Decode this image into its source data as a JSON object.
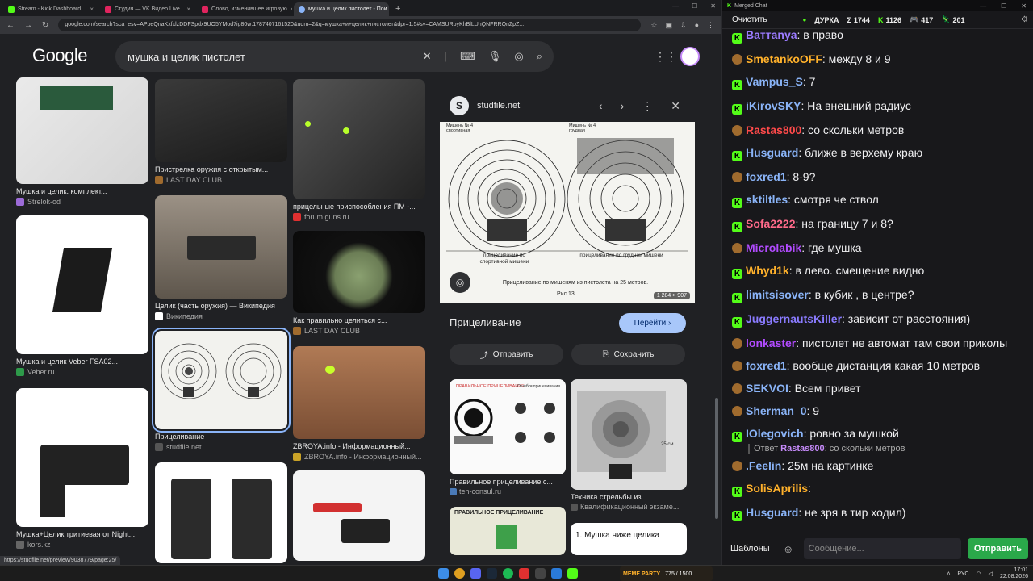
{
  "browser": {
    "tabs": [
      {
        "label": "Stream - Kick Dashboard",
        "color": "#53fc18"
      },
      {
        "label": "Студия — VK Видео Live",
        "color": "#e0245e"
      },
      {
        "label": "Слово, изменившее игровую",
        "color": "#e0245e"
      },
      {
        "label": "мушка и целик пистолет - Пои",
        "color": "#8ab4f8"
      }
    ],
    "url": "google.com/search?sca_esv=APpeQnaKxfxlzDDFSpdx9UO5YMod7ig80w:1787407161520&udm=2&q=мушка+и+целик+пистолет&dpr=1.5#sv=CAMSURoyKhBlLUhQNFRRQnZpZ..."
  },
  "google": {
    "logo": "Google",
    "query": "мушка и целик пистолет"
  },
  "results": [
    {
      "title": "Мушка и целик. комплект...",
      "source": "Strelok-od",
      "color": "#9c6bd8"
    },
    {
      "title": "Мушка и целик Veber FSA02...",
      "source": "Veber.ru",
      "color": "#2e9a4a"
    },
    {
      "title": "Мушка+Целик тритиевая от Night...",
      "source": "kors.kz",
      "color": "#666"
    },
    {
      "title": "Пристрелка оружия с открытым...",
      "source": "LAST DAY CLUB",
      "color": "#a06b2e"
    },
    {
      "title": "Целик (часть оружия) — Википедия",
      "source": "Википедия",
      "color": "#fff"
    },
    {
      "title": "Прицеливание",
      "source": "studfile.net",
      "color": "#555"
    },
    {
      "title": "прицельные приспособления ПМ -...",
      "source": "forum.guns.ru",
      "color": "#e03030"
    },
    {
      "title": "Как правильно целиться с...",
      "source": "LAST DAY CLUB",
      "color": "#a06b2e"
    },
    {
      "title": "ZBROYA.info - Информационный...",
      "source": "ZBROYA.info - Информационный...",
      "color": "#c9a227"
    }
  ],
  "panel": {
    "site": "studfile.net",
    "dimensions": "1 284 × 907",
    "title": "Прицеливание",
    "go_label": "Перейти",
    "share_label": "Отправить",
    "save_label": "Сохранить",
    "image_caption_left": "прицеливание по спортивной мишени",
    "image_caption_right": "прицеливание по грудной мишени",
    "image_caption_bottom": "Прицеливание по мишеням из пистолета на 25 метров.",
    "image_fig": "Рис.13",
    "image_label_left": "Мишень № 4 спортивная",
    "image_label_right": "Мишень № 4 грудная",
    "related": [
      {
        "title": "Правильное прицеливание с...",
        "source": "teh-consul.ru",
        "color": "#4a7ab8",
        "header": "ПРАВИЛЬНОЕ ПРИЦЕЛИВАНИЕ",
        "header2": "Ошибки прицеливания"
      },
      {
        "title": "Техника стрельбы из...",
        "source": "Квалификационный экзаме...",
        "color": "#555",
        "label_25": "25 см"
      },
      {
        "title": "",
        "source": "",
        "color": "#555",
        "header": "ПРАВИЛЬНОЕ ПРИЦЕЛИВАНИЕ"
      },
      {
        "title": "",
        "source": "",
        "color": "#555",
        "header": "1. Мушка ниже целика"
      }
    ]
  },
  "status_url": "https://studfile.net/preview/9038779/page:25/",
  "chat": {
    "title": "Merged Chat",
    "clear_label": "Очистить",
    "channel": "ДУРКА",
    "stats": [
      {
        "icon": "Σ",
        "value": "1744"
      },
      {
        "icon": "K",
        "value": "1126"
      },
      {
        "icon": "🎮",
        "value": "417"
      },
      {
        "icon": "🦎",
        "value": "201"
      }
    ],
    "messages": [
      {
        "user": "Baттаnya",
        "text": " в право",
        "color": "#9b7bff",
        "badge": "k"
      },
      {
        "user": "SmetankoOFF",
        "text": " между 8 и 9",
        "color": "#ffb12b",
        "badge": "t"
      },
      {
        "user": "Vampus_S",
        "text": " 7",
        "color": "#8ab4f8",
        "badge": "k"
      },
      {
        "user": "iKirovSKY",
        "text": " На внешний радиус",
        "color": "#8ab4f8",
        "badge": "k"
      },
      {
        "user": "Rastas800",
        "text": " со скольки метров",
        "color": "#ff4a4a",
        "badge": "t"
      },
      {
        "user": "Husguard",
        "text": " ближе в верхему краю",
        "color": "#8ab4f8",
        "badge": "k"
      },
      {
        "user": "foxred1",
        "text": " 8-9?",
        "color": "#8ab4f8",
        "badge": "t"
      },
      {
        "user": "sktiltles",
        "text": " смотря че ствол",
        "color": "#8ab4f8",
        "badge": "k"
      },
      {
        "user": "Sofa2222",
        "text": " на границу 7 и 8?",
        "color": "#ff6a8a",
        "badge": "k"
      },
      {
        "user": "Microlabik",
        "text": " где мушка",
        "color": "#b24bff",
        "badge": "t"
      },
      {
        "user": "Whyd1k",
        "text": " в лево. смещение видно",
        "color": "#ffb12b",
        "badge": "k"
      },
      {
        "user": "limitsisover",
        "text": " в кубик , в центре?",
        "color": "#8ab4f8",
        "badge": "k"
      },
      {
        "user": "JuggernautsKiller",
        "text": " зависит от расстояния)",
        "color": "#8a7bff",
        "badge": "k"
      },
      {
        "user": "lonkaster",
        "text": " пистолет не автомат там свои приколы",
        "color": "#b24bff",
        "badge": "t"
      },
      {
        "user": "foxred1",
        "text": " вообще дистанция какая 10 метров",
        "color": "#8ab4f8",
        "badge": "t"
      },
      {
        "user": "SEKVOI",
        "text": " Всем привет",
        "color": "#8ab4f8",
        "badge": "t"
      },
      {
        "user": "Sherman_0",
        "text": " 9",
        "color": "#8ab4f8",
        "badge": "t"
      },
      {
        "user": "IOlegovich",
        "text": " ровно за мушкой",
        "color": "#8ab4f8",
        "badge": "k"
      },
      {
        "user": ".Feelin",
        "text": " 25м на картинке",
        "color": "#8ab4f8",
        "badge": "t"
      },
      {
        "user": "SolisAprilis",
        "text": " ",
        "color": "#ffb12b",
        "badge": "k"
      },
      {
        "user": "Husguard",
        "text": " не зря в тир ходил)",
        "color": "#8ab4f8",
        "badge": "k"
      }
    ],
    "reply": {
      "prefix": "Ответ",
      "user": "Rastas800",
      "text": "со скольки метров"
    },
    "templates_label": "Шаблоны",
    "input_placeholder": "Сообщение...",
    "send_label": "Отправить"
  },
  "taskbar": {
    "meme_label": "MEME PARTY",
    "meme_count": "775 / 1500",
    "lang": "РУС",
    "time": "17:01",
    "date": "22.08.2026"
  }
}
